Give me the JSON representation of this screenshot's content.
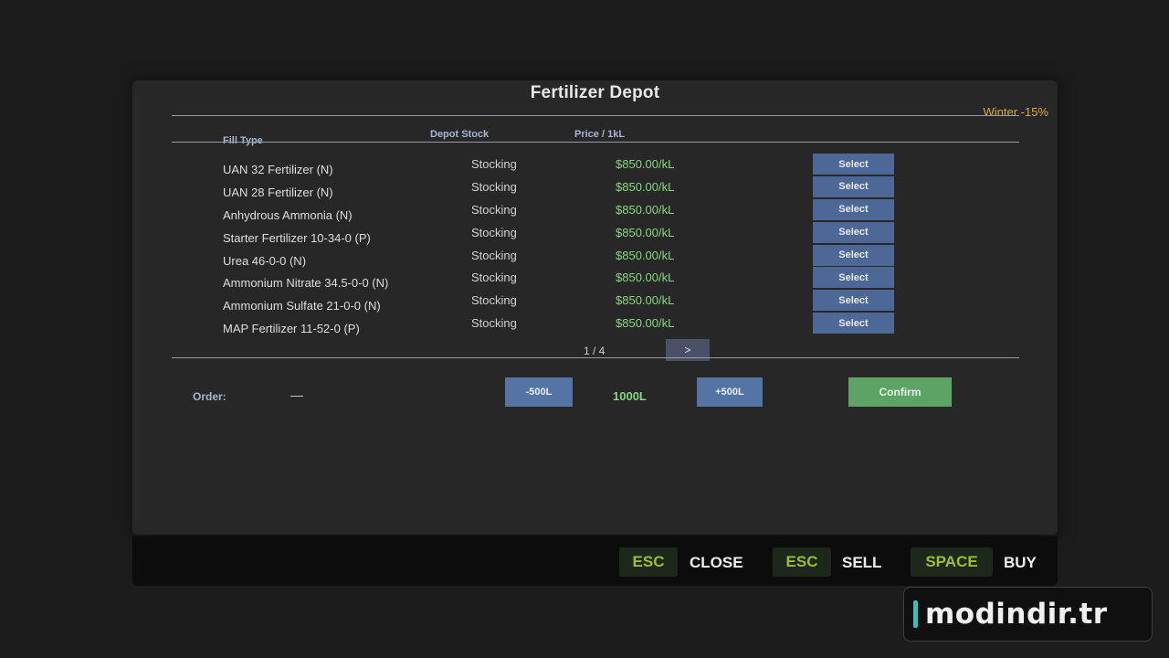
{
  "window": {
    "title": "Fertilizer Depot",
    "season_note": "Winter -15%"
  },
  "columns": {
    "fill_type": "Fill Type",
    "depot_stock": "Depot Stock",
    "price": "Price / 1kL"
  },
  "rows": [
    {
      "name": "UAN 32 Fertilizer (N)",
      "stock": "Stocking",
      "price": "$850.00/kL",
      "action": "Select"
    },
    {
      "name": "UAN 28 Fertilizer (N)",
      "stock": "Stocking",
      "price": "$850.00/kL",
      "action": "Select"
    },
    {
      "name": "Anhydrous Ammonia (N)",
      "stock": "Stocking",
      "price": "$850.00/kL",
      "action": "Select"
    },
    {
      "name": "Starter Fertilizer 10-34-0 (P)",
      "stock": "Stocking",
      "price": "$850.00/kL",
      "action": "Select"
    },
    {
      "name": "Urea 46-0-0 (N)",
      "stock": "Stocking",
      "price": "$850.00/kL",
      "action": "Select"
    },
    {
      "name": "Ammonium Nitrate 34.5-0-0 (N)",
      "stock": "Stocking",
      "price": "$850.00/kL",
      "action": "Select"
    },
    {
      "name": "Ammonium Sulfate 21-0-0 (N)",
      "stock": "Stocking",
      "price": "$850.00/kL",
      "action": "Select"
    },
    {
      "name": "MAP Fertilizer 11-52-0 (P)",
      "stock": "Stocking",
      "price": "$850.00/kL",
      "action": "Select"
    }
  ],
  "pager": {
    "text": "1 / 4",
    "next_label": ">"
  },
  "order": {
    "label": "Order:",
    "value": "—",
    "minus_label": "-500L",
    "quantity": "1000L",
    "plus_label": "+500L",
    "confirm_label": "Confirm"
  },
  "footer": {
    "keys": [
      {
        "key": "ESC",
        "action": "CLOSE"
      },
      {
        "key": "ESC",
        "action": "SELL"
      },
      {
        "key": "SPACE",
        "action": "BUY"
      }
    ]
  },
  "watermark": {
    "text": "modindir.tr"
  },
  "colors": {
    "accent_green": "#86d77f",
    "button_blue": "#4d6796",
    "confirm_green": "#5da366",
    "season_gold": "#d6b03a",
    "key_green": "#9ac02a"
  }
}
